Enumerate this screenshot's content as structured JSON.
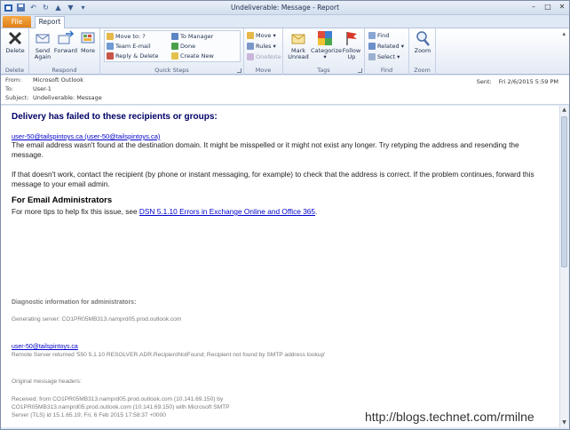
{
  "window": {
    "title": "Undeliverable: Message - Report"
  },
  "tabs": {
    "file": "File",
    "report": "Report"
  },
  "ribbon": {
    "delete_group": {
      "label": "Delete",
      "delete": "Delete"
    },
    "respond_group": {
      "label": "Respond",
      "send_again": "Send Again",
      "forward": "Forward",
      "more": "More"
    },
    "quick_steps": {
      "label": "Quick Steps",
      "items": [
        "Move to: ?",
        "To Manager",
        "Team E-mail",
        "Done",
        "Reply & Delete",
        "Create New"
      ]
    },
    "move_group": {
      "label": "Move",
      "move": "Move",
      "rules": "Rules",
      "onenote": "OneNote"
    },
    "tags_group": {
      "label": "Tags",
      "mark_unread": "Mark Unread",
      "categorize": "Categorize",
      "follow_up": "Follow Up"
    },
    "find_group": {
      "label": "Find",
      "find": "Find",
      "related": "Related",
      "select": "Select"
    },
    "zoom_group": {
      "label": "Zoom",
      "zoom": "Zoom"
    }
  },
  "header": {
    "from_label": "From:",
    "from": "Microsoft Outlook",
    "to_label": "To:",
    "to": "User-1",
    "subject_label": "Subject:",
    "subject": "Undeliverable: Message",
    "sent_label": "Sent:",
    "sent": "Fri 2/6/2015 5:59 PM"
  },
  "body": {
    "heading": "Delivery has failed to these recipients or groups:",
    "recipient_link": "user-50@tailspintoys.ca (user-50@tailspintoys.ca)",
    "paragraph1": "The email address wasn't found at the destination domain. It might be misspelled or it might not exist any longer. Try retyping the address and resending the message.",
    "paragraph2": "If that doesn't work, contact the recipient (by phone or instant messaging, for example) to check that the address is correct. If the problem continues, forward this message to your email admin.",
    "admin_heading": "For Email Administrators",
    "admin_text": "For more tips to help fix this issue, see ",
    "admin_link": "DSN 5.1.10 Errors in Exchange Online and Office 365",
    "admin_tail": ".",
    "diag_title": "Diagnostic information for administrators:",
    "generating_server": "Generating server: CO1PR05MB313.namprd05.prod.outlook.com",
    "recipient2": "user-50@tailspintoys.ca",
    "remote_server": "Remote Server returned '550 5.1.10 RESOLVER.ADR.RecipientNotFound; Recipient not found by SMTP address lookup'",
    "orig_headers": "Original message headers:",
    "received1": "Received: from CO1PR05MB313.namprd05.prod.outlook.com (10.141.69.150) by",
    "received2": " CO1PR05MB313.namprd05.prod.outlook.com (10.141.69.150) with Microsoft SMTP",
    "received3": " Server (TLS) id 15.1.65.19; Fri, 6 Feb 2015 17:58:37 +0000"
  },
  "watermark": "http://blogs.technet.com/rmilne"
}
